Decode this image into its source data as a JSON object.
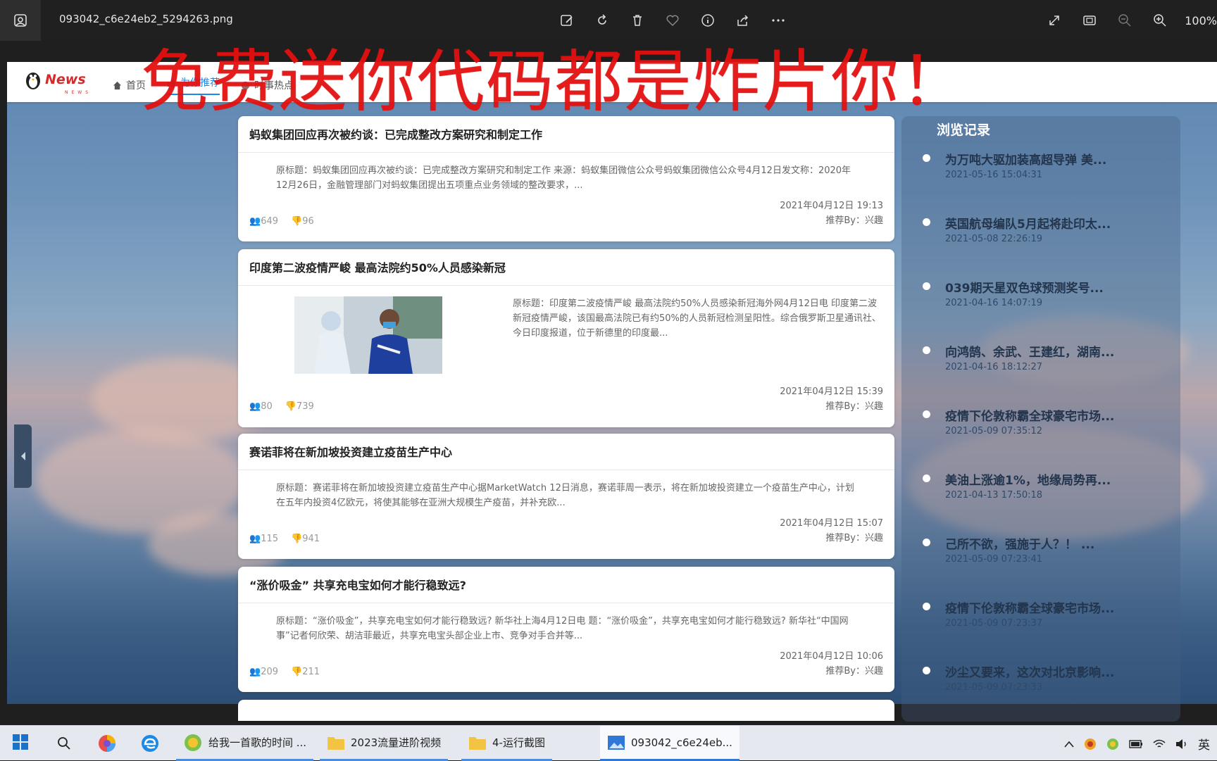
{
  "titlebar": {
    "filename": "093042_c6e24eb2_5294263.png",
    "zoom": "100%",
    "tools": [
      "edit-image-icon",
      "rotate-icon",
      "delete-icon",
      "favorite-icon",
      "info-icon",
      "share-icon",
      "more-icon"
    ],
    "right_tools": [
      "fullscreen-icon",
      "fit-window-icon",
      "zoom-out-icon",
      "zoom-in-icon"
    ]
  },
  "site": {
    "logo_text": "News",
    "logo_sub": "NEWS",
    "nav": [
      "首页",
      "为你推荐",
      "时事热点"
    ]
  },
  "watermark": "免费送你代码都是炸片你！",
  "articles": [
    {
      "title": "蚂蚁集团回应再次被约谈：已完成整改方案研究和制定工作",
      "summary": "原标题：蚂蚁集团回应再次被约谈：已完成整改方案研究和制定工作 来源：蚂蚁集团微信公众号蚂蚁集团微信公众号4月12日发文称：2020年12月26日，金融管理部门对蚂蚁集团提出五项重点业务领域的整改要求，...",
      "date": "2021年04月12日 19:13",
      "recommender": "推荐By：兴趣",
      "views": "649",
      "dislikes": "96"
    },
    {
      "title": "印度第二波疫情严峻 最高法院约50%人员感染新冠",
      "summary": "原标题：印度第二波疫情严峻 最高法院约50%人员感染新冠海外网4月12日电 印度第二波新冠疫情严峻，该国最高法院已有约50%的人员新冠检测呈阳性。综合俄罗斯卫星通讯社、今日印度报道，位于新德里的印度最...",
      "date": "2021年04月12日 15:39",
      "recommender": "推荐By：兴趣",
      "views": "80",
      "dislikes": "739"
    },
    {
      "title": "赛诺菲将在新加坡投资建立疫苗生产中心",
      "summary": "原标题：赛诺菲将在新加坡投资建立疫苗生产中心据MarketWatch 12日消息，赛诺菲周一表示，将在新加坡投资建立一个疫苗生产中心，计划在五年内投资4亿欧元，将使其能够在亚洲大规模生产疫苗，并补充欧...",
      "date": "2021年04月12日 15:07",
      "recommender": "推荐By：兴趣",
      "views": "115",
      "dislikes": "941"
    },
    {
      "title": "“涨价吸金” 共享充电宝如何才能行稳致远?",
      "summary": "原标题：“涨价吸金”，共享充电宝如何才能行稳致远? 新华社上海4月12日电 题：“涨价吸金”，共享充电宝如何才能行稳致远? 新华社“中国网事”记者何欣荣、胡洁菲最近，共享充电宝头部企业上市、竞争对手合并等...",
      "date": "2021年04月12日 10:06",
      "recommender": "推荐By：兴趣",
      "views": "209",
      "dislikes": "211"
    }
  ],
  "sidebar": {
    "title": "浏览记录",
    "history": [
      {
        "title": "为万吨大驱加装高超导弹 美...",
        "time": "2021-05-16 15:04:31"
      },
      {
        "title": "英国航母编队5月起将赴印太...",
        "time": "2021-05-08 22:26:19"
      },
      {
        "title": "039期天星双色球预测奖号...",
        "time": "2021-04-16 14:07:19"
      },
      {
        "title": "向鸿鹄、余武、王建红，湖南...",
        "time": "2021-04-16 18:12:27"
      },
      {
        "title": "疫情下伦敦称霸全球豪宅市场...",
        "time": "2021-05-09 07:35:12"
      },
      {
        "title": "美油上涨逾1%，地缘局势再...",
        "time": "2021-04-13 17:50:18"
      },
      {
        "title": "己所不欲，强施于人？！ ...",
        "time": "2021-05-09 07:23:41"
      },
      {
        "title": "疫情下伦敦称霸全球豪宅市场...",
        "time": "2021-05-09 07:23:37"
      },
      {
        "title": "沙尘又要来，这次对北京影响...",
        "time": "2021-05-09 07:23:33"
      }
    ]
  },
  "taskbar": {
    "apps": [
      {
        "label": "给我一首歌的时间 ..."
      },
      {
        "label": "2023流量进阶视频"
      },
      {
        "label": "4-运行截图"
      },
      {
        "label": "093042_c6e24eb..."
      }
    ],
    "ime": "英"
  }
}
